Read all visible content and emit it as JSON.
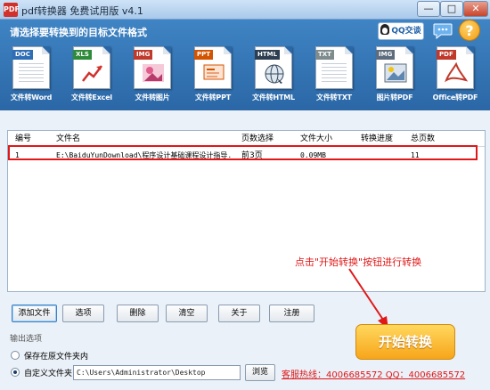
{
  "window": {
    "title": "pdf转换器 免费试用版 v4.1",
    "app_icon": "PDF",
    "min_symbol": "—",
    "max_symbol": "□",
    "close_symbol": "✕"
  },
  "header": {
    "title": "请选择要转换到的目标文件格式",
    "qq_label": "QQ交谈",
    "help_symbol": "?"
  },
  "tools": [
    {
      "label": "文件转Word",
      "tag": "DOC",
      "color": "#2f6db5",
      "icon": "word-doc-icon"
    },
    {
      "label": "文件转Excel",
      "tag": "XLS",
      "color": "#2e8b3a",
      "icon": "excel-doc-icon"
    },
    {
      "label": "文件转图片",
      "tag": "IMG",
      "color": "#c0392b",
      "icon": "image-doc-icon"
    },
    {
      "label": "文件转PPT",
      "tag": "PPT",
      "color": "#d35400",
      "icon": "ppt-doc-icon"
    },
    {
      "label": "文件转HTML",
      "tag": "HTML",
      "color": "#2c3e50",
      "icon": "html-doc-icon"
    },
    {
      "label": "文件转TXT",
      "tag": "TXT",
      "color": "#7f8c8d",
      "icon": "txt-doc-icon"
    },
    {
      "label": "图片转PDF",
      "tag": "IMG",
      "color": "#5d6d7e",
      "icon": "image-to-pdf-icon"
    },
    {
      "label": "Office转PDF",
      "tag": "PDF",
      "color": "#c0392b",
      "icon": "office-to-pdf-icon"
    }
  ],
  "table": {
    "columns": [
      "编号",
      "文件名",
      "页数选择",
      "文件大小",
      "转换进度",
      "总页数"
    ],
    "rows": [
      {
        "no": "1",
        "name": "E:\\BaiduYunDownload\\程序设计基础课程设计指导...",
        "pages": "前3页",
        "size": "0.09MB",
        "progress": "",
        "total": "11"
      }
    ]
  },
  "annotation": "点击\"开始转换\"按钮进行转换",
  "buttons": {
    "add": "添加文件",
    "options": "选项",
    "delete": "删除",
    "clear": "清空",
    "about": "关于",
    "register": "注册"
  },
  "output": {
    "section_label": "输出选项",
    "option_source": "保存在原文件夹内",
    "option_custom": "自定义文件夹",
    "path": "C:\\Users\\Administrator\\Desktop",
    "browse": "浏览"
  },
  "start_button": "开始转换",
  "hotline": "客服热线：4006685572 QQ：4006685572"
}
